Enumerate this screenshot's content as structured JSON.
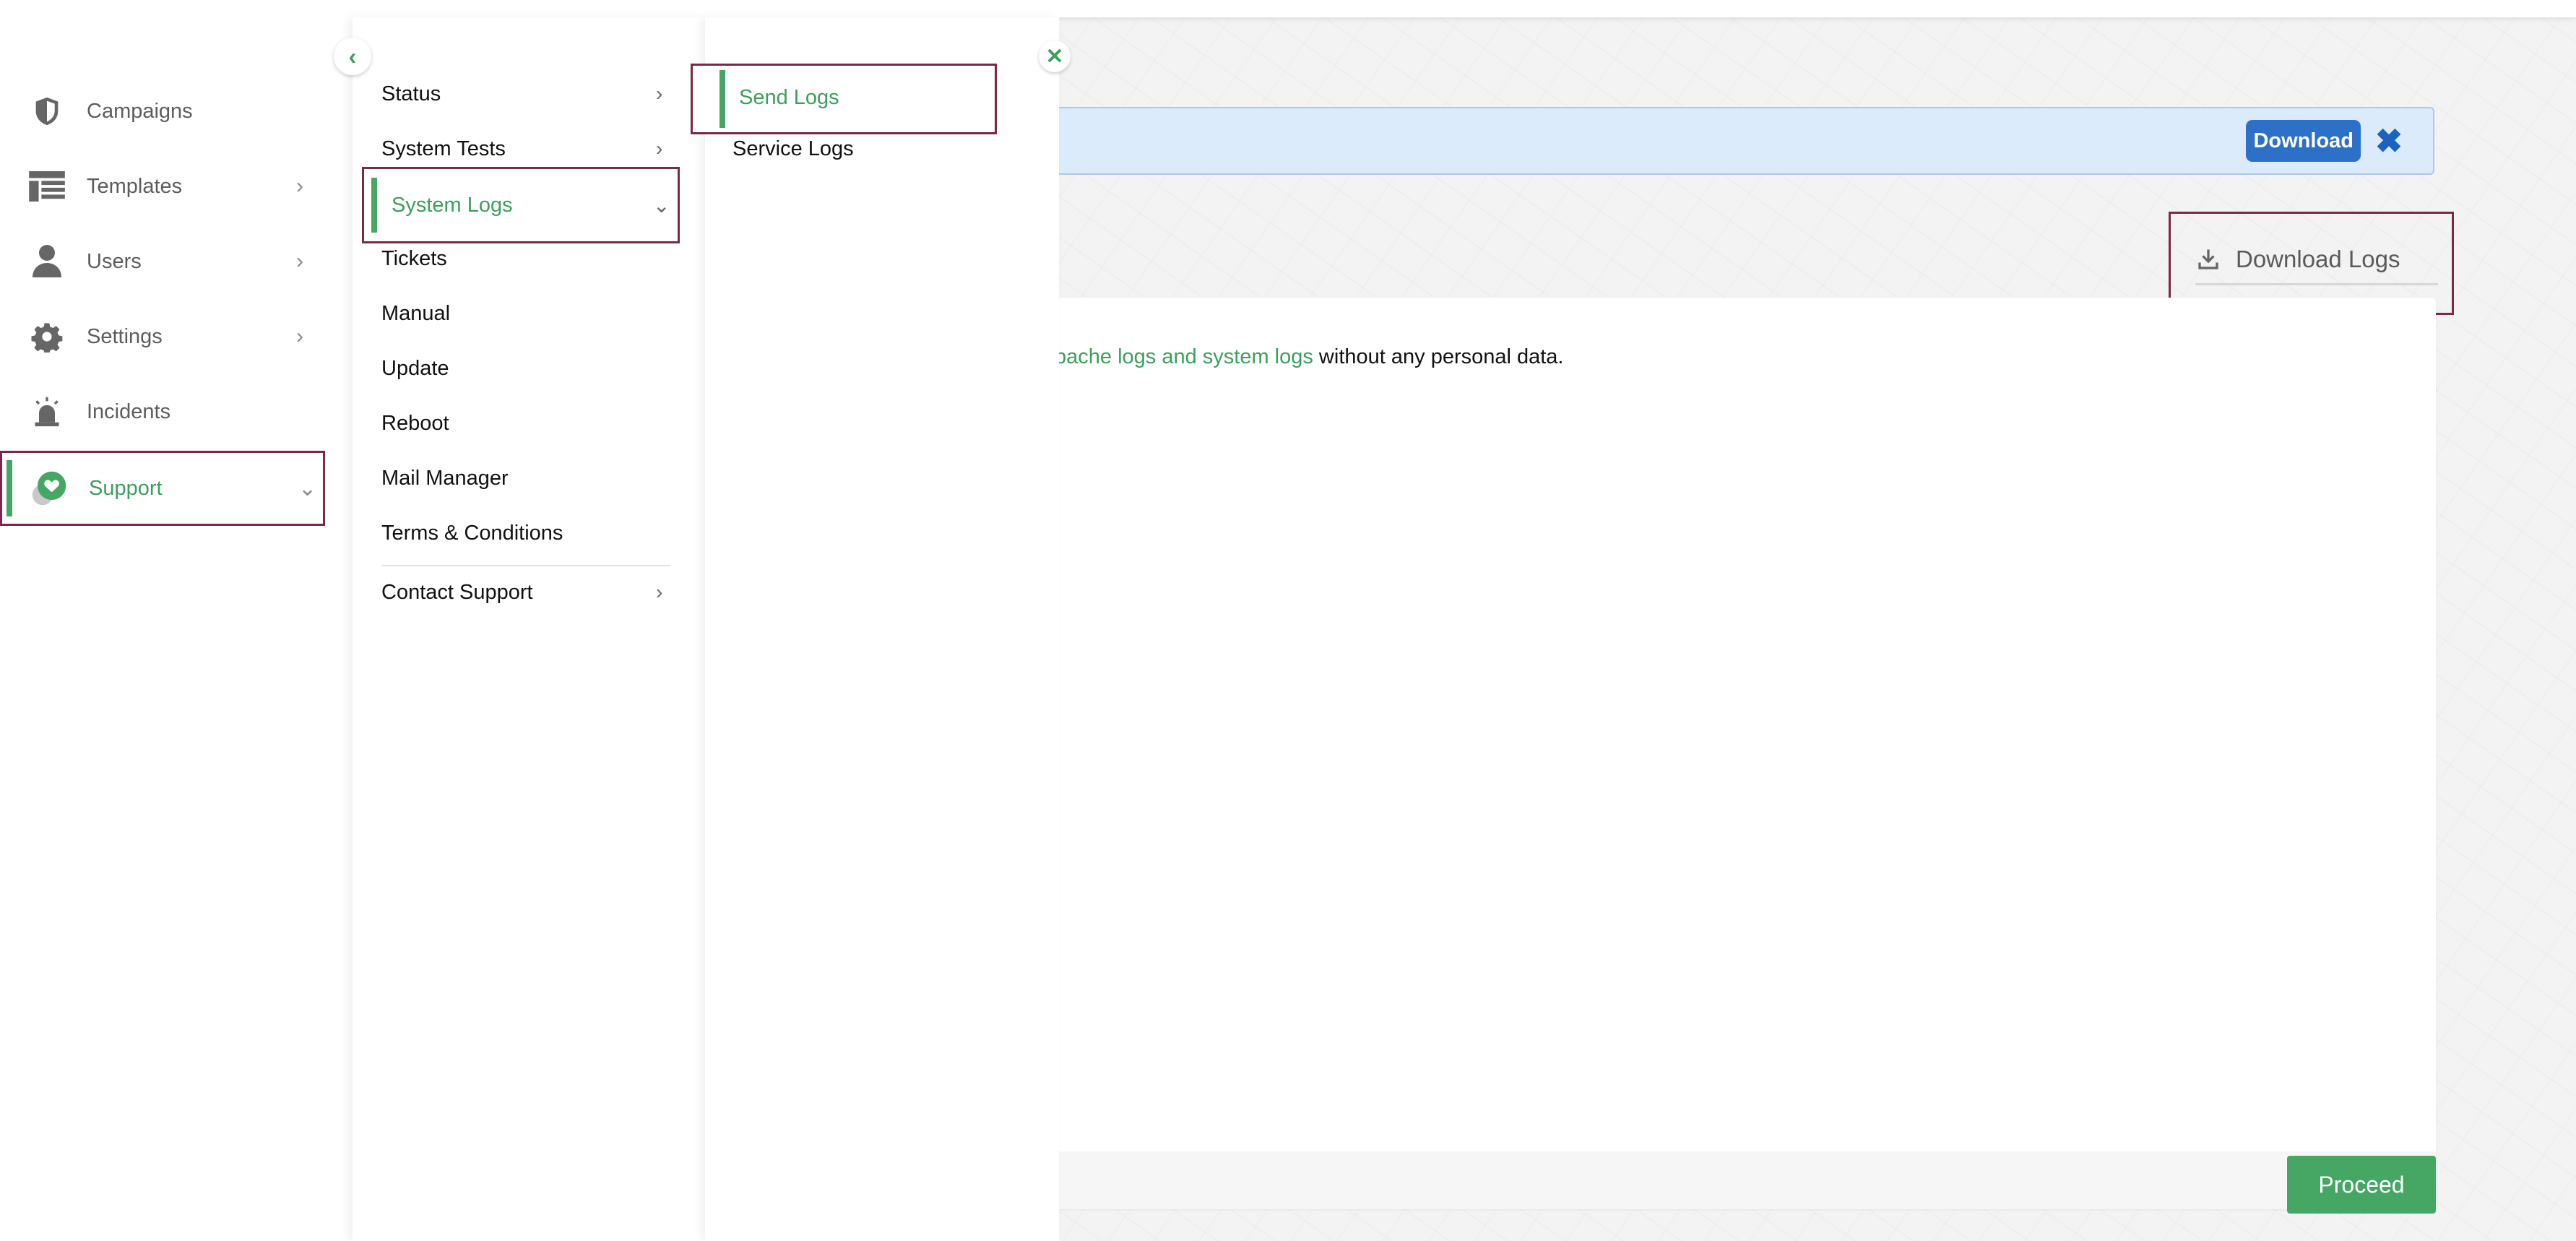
{
  "sidebar": {
    "items": [
      {
        "label": "Campaigns",
        "icon": "shield-icon"
      },
      {
        "label": "Templates",
        "icon": "templates-icon",
        "chevron": "›"
      },
      {
        "label": "Users",
        "icon": "user-icon",
        "chevron": "›"
      },
      {
        "label": "Settings",
        "icon": "gear-icon",
        "chevron": "›"
      },
      {
        "label": "Incidents",
        "icon": "alarm-icon"
      },
      {
        "label": "Support",
        "icon": "support-heart-icon",
        "chevron": "⌄"
      }
    ]
  },
  "support_menu": {
    "items": [
      {
        "label": "Status",
        "chevron": "›"
      },
      {
        "label": "System Tests",
        "chevron": "›"
      },
      {
        "label": "System Logs",
        "chevron": "⌄"
      },
      {
        "label": "Tickets"
      },
      {
        "label": "Manual"
      },
      {
        "label": "Update"
      },
      {
        "label": "Reboot"
      },
      {
        "label": "Mail Manager"
      },
      {
        "label": "Terms & Conditions"
      },
      {
        "label": "Contact Support",
        "chevron": "›"
      }
    ],
    "collapse_glyph": "‹"
  },
  "logs_menu": {
    "items": [
      {
        "label": "Send Logs"
      },
      {
        "label": "Service Logs"
      }
    ],
    "close_glyph": "✕"
  },
  "notice": {
    "download_label": "Download",
    "close_glyph": "✖"
  },
  "download_logs": {
    "label": "Download Logs"
  },
  "card": {
    "text_link": "pache logs and system logs",
    "text_rest": " without any personal data.",
    "proceed_label": "Proceed"
  },
  "colors": {
    "accent_green": "#46a764",
    "highlight_border": "#7b2944",
    "primary_blue": "#2d70c8",
    "notice_bg": "#dcebfb"
  }
}
